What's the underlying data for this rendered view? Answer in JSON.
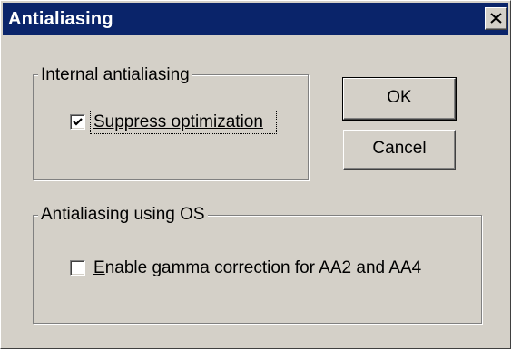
{
  "window": {
    "title": "Antialiasing",
    "close_icon": "close-icon"
  },
  "internal_group": {
    "label": "Internal antialiasing",
    "suppress_optimization": {
      "label": "Suppress optimization",
      "checked": true
    }
  },
  "os_group": {
    "label": "Antialiasing using OS",
    "gamma_correction": {
      "label_accel": "E",
      "label_rest": "nable gamma correction for AA2 and AA4",
      "checked": false
    }
  },
  "buttons": {
    "ok_label": "OK",
    "cancel_label": "Cancel"
  },
  "colors": {
    "titlebar": "#0a246a",
    "face": "#d4d0c8"
  }
}
